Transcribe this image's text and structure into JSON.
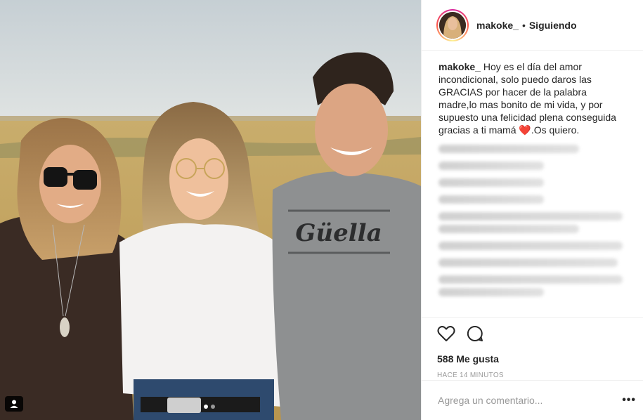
{
  "post": {
    "username": "makoke_",
    "separator": "•",
    "follow_status": "Siguiendo",
    "caption": {
      "user": "makoke_",
      "text": "Hoy es el día del amor incondicional, solo puedo daros las GRACIAS por hacer de la palabra madre,lo mas bonito de mi vida, y por supuesto una felicidad plena conseguida gracias a ti mamá",
      "emoji": "❤️",
      "text_end": ".Os quiero."
    },
    "likes": "588 Me gusta",
    "time": "HACE 14 MINUTOS",
    "comment_placeholder": "Agrega un comentario...",
    "more_options": "•••"
  },
  "photo": {
    "shirt_brand": "Güella"
  },
  "colors": {
    "accent_heart": "#ed1c24",
    "border": "#efefef",
    "muted_text": "#999999",
    "primary_text": "#262626"
  },
  "icons": {
    "like": "heart-outline-icon",
    "comment": "comment-bubble-icon",
    "tag": "user-tag-icon",
    "more": "more-options-icon"
  }
}
